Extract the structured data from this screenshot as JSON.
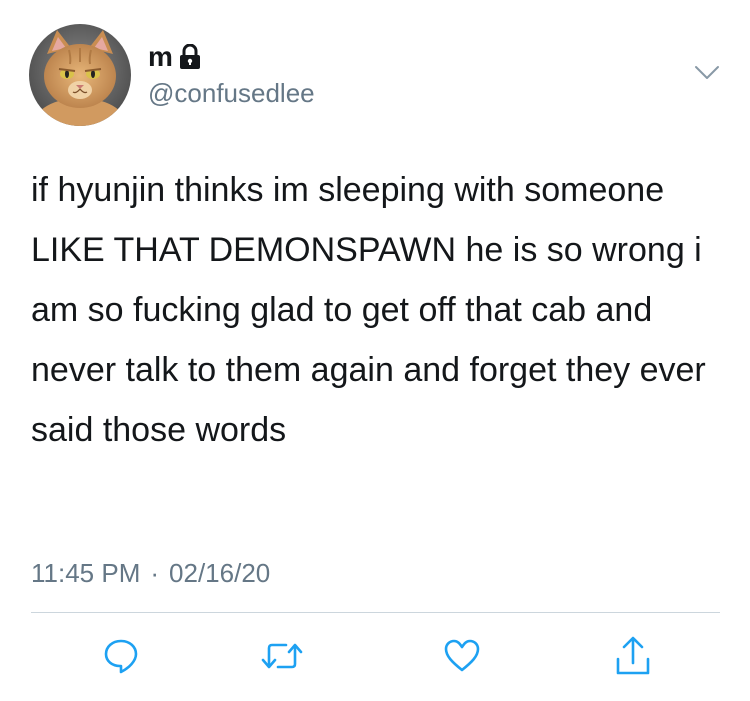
{
  "user": {
    "display_name": "m",
    "handle": "@confusedlee",
    "avatar_icon": "cat-avatar",
    "lock_icon": "lock-icon"
  },
  "tweet": {
    "text": "if hyunjin thinks im sleeping with someone LIKE THAT DEMONSPAWN he is so wrong i am so fucking glad to get off that cab and never talk to them again and forget they ever said those words",
    "time": "11:45 PM",
    "separator": "·",
    "date": "02/16/20"
  },
  "actions": {
    "reply_icon": "reply-icon",
    "retweet_icon": "retweet-icon",
    "like_icon": "heart-icon",
    "share_icon": "share-icon"
  },
  "colors": {
    "text": "#14171a",
    "secondary": "#657786",
    "icon": "#1da1f2",
    "divider": "#ccd6dd"
  }
}
